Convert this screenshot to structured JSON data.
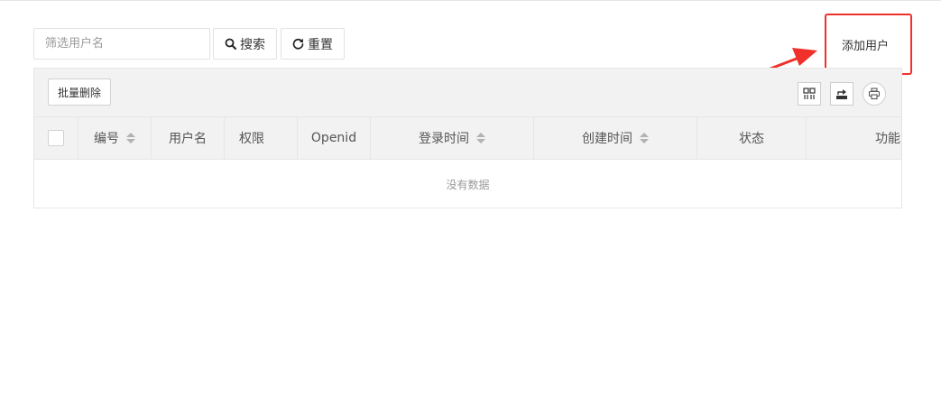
{
  "search": {
    "placeholder": "筛选用户名",
    "search_label": "搜索",
    "reset_label": "重置"
  },
  "add_user": {
    "label": "添加用户"
  },
  "toolbar": {
    "batch_delete_label": "批量删除",
    "icons": [
      "columns-icon",
      "export-icon",
      "print-icon"
    ]
  },
  "table": {
    "columns": [
      {
        "label": "编号",
        "sortable": true
      },
      {
        "label": "用户名",
        "sortable": false
      },
      {
        "label": "权限",
        "sortable": false
      },
      {
        "label": "Openid",
        "sortable": false
      },
      {
        "label": "登录时间",
        "sortable": true
      },
      {
        "label": "创建时间",
        "sortable": true
      },
      {
        "label": "状态",
        "sortable": false
      },
      {
        "label": "功能",
        "sortable": false
      }
    ],
    "empty_text": "没有数据"
  },
  "colors": {
    "highlight": "#f0302a",
    "header_bg": "#f2f2f2",
    "border": "#e6e6e6"
  }
}
